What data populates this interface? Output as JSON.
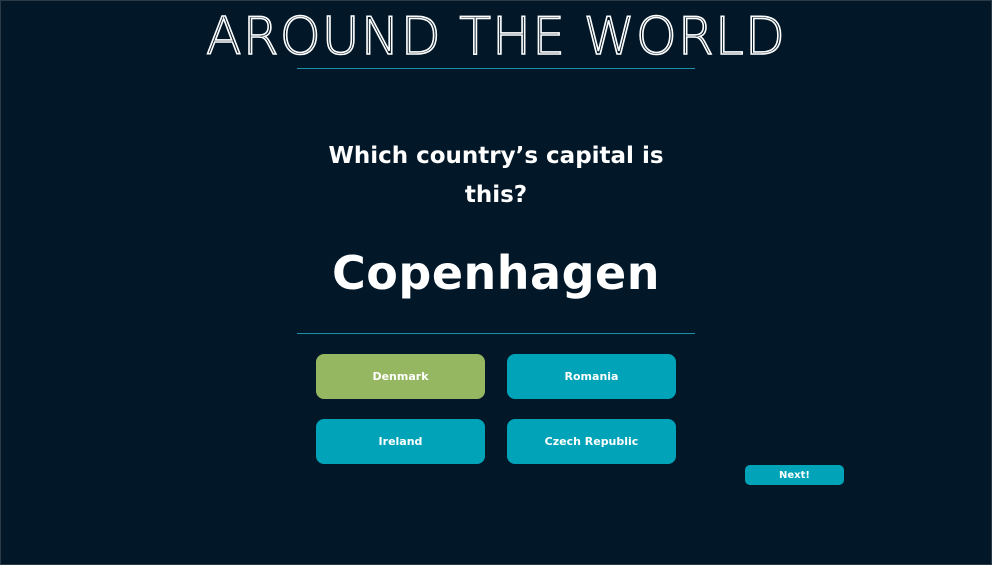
{
  "app": {
    "title": "AROUND THE WORLD"
  },
  "quiz": {
    "question": "Which country’s capital is this?",
    "capital": "Copenhagen",
    "answers": [
      {
        "label": "Denmark",
        "state": "correct"
      },
      {
        "label": "Romania",
        "state": "default"
      },
      {
        "label": "Ireland",
        "state": "default"
      },
      {
        "label": "Czech Republic",
        "state": "default"
      }
    ],
    "next_label": "Next!"
  },
  "colors": {
    "background": "#021828",
    "button": "#00a3b8",
    "correct": "#95b762",
    "divider": "#1c8fa8",
    "text": "#ffffff"
  }
}
